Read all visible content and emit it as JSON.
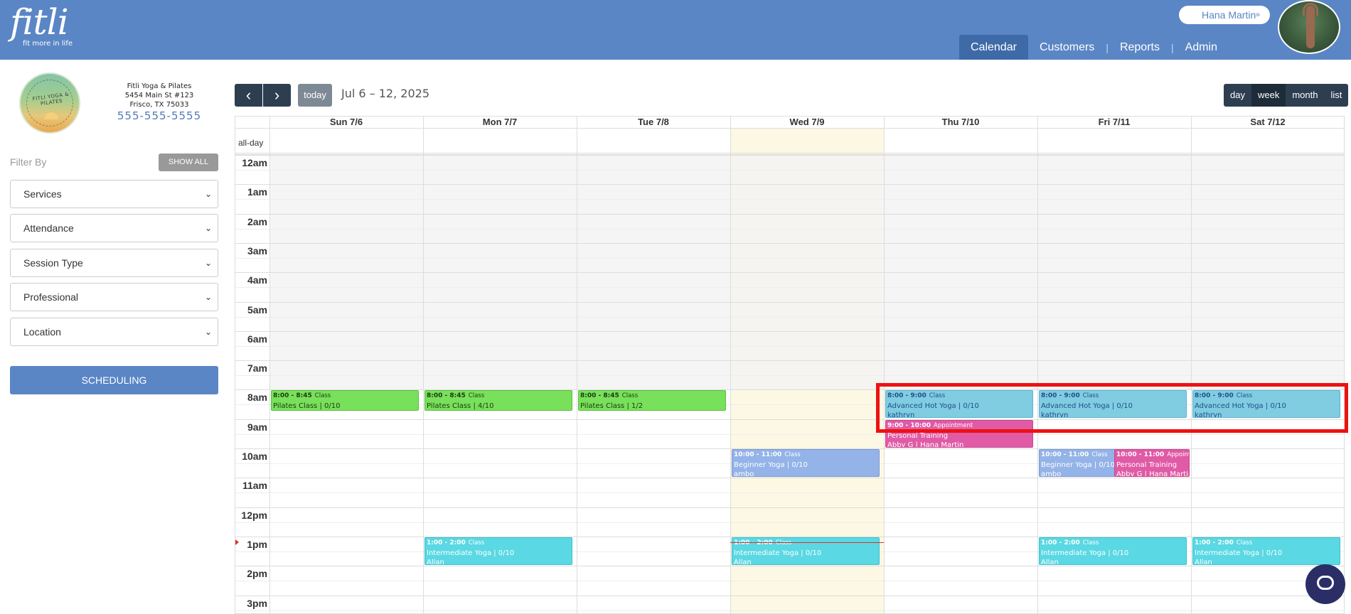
{
  "header": {
    "logo": "fitli",
    "tagline": "fit more in life",
    "user_name": "Hana Martin",
    "user_chevron": "»",
    "nav": [
      {
        "label": "Calendar",
        "active": true
      },
      {
        "label": "Customers",
        "active": false
      },
      {
        "label": "Reports",
        "active": false
      },
      {
        "label": "Admin",
        "active": false
      }
    ],
    "nav_separator": "|"
  },
  "sidebar": {
    "logo_text": "FITLI YOGA & PILATES",
    "studio_name": "Fitli Yoga & Pilates",
    "address1": "5454 Main St #123",
    "address2": "Frisco, TX 75033",
    "phone": "555-555-5555",
    "filter_label": "Filter By",
    "show_all": "SHOW ALL",
    "filters": [
      {
        "label": "Services"
      },
      {
        "label": "Attendance"
      },
      {
        "label": "Session Type"
      },
      {
        "label": "Professional"
      },
      {
        "label": "Location"
      }
    ],
    "scheduling": "SCHEDULING"
  },
  "toolbar": {
    "prev": "‹",
    "next": "›",
    "today": "today",
    "range": "Jul 6 – 12, 2025",
    "views": [
      {
        "label": "day",
        "active": false
      },
      {
        "label": "week",
        "active": true
      },
      {
        "label": "month",
        "active": false
      },
      {
        "label": "list",
        "active": false
      }
    ]
  },
  "calendar": {
    "allday_label": "all-day",
    "days": [
      "Sun 7/6",
      "Mon 7/7",
      "Tue 7/8",
      "Wed 7/9",
      "Thu 7/10",
      "Fri 7/11",
      "Sat 7/12"
    ],
    "today_index": 3,
    "hours": [
      "12am",
      "1am",
      "2am",
      "3am",
      "4am",
      "5am",
      "6am",
      "7am",
      "8am",
      "9am",
      "10am",
      "11am",
      "12pm",
      "1pm",
      "2pm",
      "3pm"
    ],
    "events": [
      {
        "day": 0,
        "start": 8,
        "end": 8.75,
        "time": "8:00 - 8:45",
        "kind": "Class",
        "title": "Pilates Class | 0/10",
        "who": "",
        "color": "green"
      },
      {
        "day": 1,
        "start": 8,
        "end": 8.75,
        "time": "8:00 - 8:45",
        "kind": "Class",
        "title": "Pilates Class | 4/10",
        "who": "",
        "color": "green"
      },
      {
        "day": 2,
        "start": 8,
        "end": 8.75,
        "time": "8:00 - 8:45",
        "kind": "Class",
        "title": "Pilates Class | 1/2",
        "who": "",
        "color": "green"
      },
      {
        "day": 4,
        "start": 8,
        "end": 9,
        "time": "8:00 - 9:00",
        "kind": "Class",
        "title": "Advanced Hot Yoga | 0/10",
        "who": "kathryn",
        "color": "blue"
      },
      {
        "day": 5,
        "start": 8,
        "end": 9,
        "time": "8:00 - 9:00",
        "kind": "Class",
        "title": "Advanced Hot Yoga | 0/10",
        "who": "kathryn",
        "color": "blue"
      },
      {
        "day": 6,
        "start": 8,
        "end": 9,
        "time": "8:00 - 9:00",
        "kind": "Class",
        "title": "Advanced Hot Yoga | 0/10",
        "who": "kathryn",
        "color": "blue"
      },
      {
        "day": 4,
        "start": 9,
        "end": 10,
        "time": "9:00 - 10:00",
        "kind": "Appointment",
        "title": "Personal Training",
        "who": "Abby G | Hana Martin",
        "color": "pink"
      },
      {
        "day": 3,
        "start": 10,
        "end": 11,
        "time": "10:00 - 11:00",
        "kind": "Class",
        "title": "Beginner Yoga | 0/10",
        "who": "ambo",
        "color": "periwinkle"
      },
      {
        "day": 5,
        "start": 10,
        "end": 11,
        "time": "10:00 - 11:00",
        "kind": "Class",
        "title": "Beginner Yoga | 0/10",
        "who": "ambo",
        "color": "periwinkle",
        "half": "left"
      },
      {
        "day": 5,
        "start": 10,
        "end": 11,
        "time": "10:00 - 11:00",
        "kind": "Appointment",
        "title": "Personal Training",
        "who": "Abby G | Hana Martin",
        "color": "pink",
        "half": "right"
      },
      {
        "day": 1,
        "start": 13,
        "end": 14,
        "time": "1:00 - 2:00",
        "kind": "Class",
        "title": "Intermediate Yoga | 0/10",
        "who": "Allan",
        "color": "cyan"
      },
      {
        "day": 3,
        "start": 13,
        "end": 14,
        "time": "1:00 - 2:00",
        "kind": "Class",
        "title": "Intermediate Yoga | 0/10",
        "who": "Allan",
        "color": "cyan"
      },
      {
        "day": 5,
        "start": 13,
        "end": 14,
        "time": "1:00 - 2:00",
        "kind": "Class",
        "title": "Intermediate Yoga | 0/10",
        "who": "Allan",
        "color": "cyan"
      },
      {
        "day": 6,
        "start": 13,
        "end": 14,
        "time": "1:00 - 2:00",
        "kind": "Class",
        "title": "Intermediate Yoga | 0/10",
        "who": "Allan",
        "color": "cyan"
      }
    ],
    "now_hour": 13.2
  },
  "colors": {
    "brand": "#5a86c5",
    "toolbar_dark": "#2c3e50",
    "today_bg": "#fcf8e3",
    "highlight": "#ee1111"
  },
  "icons": {
    "chat": "chat-bubble-icon",
    "avatar": "user-photo"
  }
}
